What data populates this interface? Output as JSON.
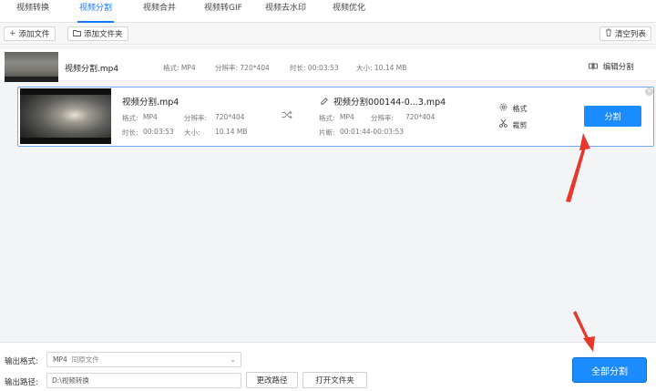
{
  "tabs": [
    {
      "label": "视频转换",
      "active": false
    },
    {
      "label": "视频分割",
      "active": true
    },
    {
      "label": "视频合并",
      "active": false
    },
    {
      "label": "视频转GIF",
      "active": false
    },
    {
      "label": "视频去水印",
      "active": false
    },
    {
      "label": "视频优化",
      "active": false
    }
  ],
  "toolbar": {
    "add_file": "添加文件",
    "add_folder": "添加文件夹",
    "clear_list": "清空列表"
  },
  "file_row": {
    "name": "视频分割.mp4",
    "format": "格式: MP4",
    "resolution": "分辨率: 720*404",
    "duration": "时长: 00:03:53",
    "size": "大小: 10.14 MB",
    "edit_split": "编辑分割"
  },
  "segment_card": {
    "source": {
      "name": "视频分割.mp4",
      "format_label": "格式:",
      "format_value": "MP4",
      "resolution_label": "分辨率:",
      "resolution_value": "720*404",
      "duration_label": "时长:",
      "duration_value": "00:03:53",
      "size_label": "大小:",
      "size_value": "10.14 MB"
    },
    "output": {
      "name": "视频分割000144-0...3.mp4",
      "format_label": "格式:",
      "format_value": "MP4",
      "resolution_label": "分辨率:",
      "resolution_value": "720*404",
      "clip_label": "片断:",
      "clip_value": "00:01:44-00:03:53"
    },
    "format_option": "格式",
    "crop_option": "裁剪",
    "split_button": "分割"
  },
  "bottom": {
    "output_format_label": "输出格式:",
    "output_format_value": "MP4",
    "output_format_sub": "同原文件",
    "output_path_label": "输出路径:",
    "output_path_value": "D:\\视频转换",
    "change_path": "更改路径",
    "open_folder": "打开文件夹",
    "split_all": "全部分割"
  },
  "colors": {
    "accent": "#1677ff",
    "button_blue": "#1a8cff",
    "annotation_arrow": "#e8372c"
  },
  "icons": [
    "plus-icon",
    "folder-icon",
    "trash-icon",
    "edit-split-icon",
    "shuffle-icon",
    "pencil-icon",
    "gear-icon",
    "scissors-icon",
    "close-icon",
    "chevron-down-icon",
    "arrow-annotation"
  ]
}
